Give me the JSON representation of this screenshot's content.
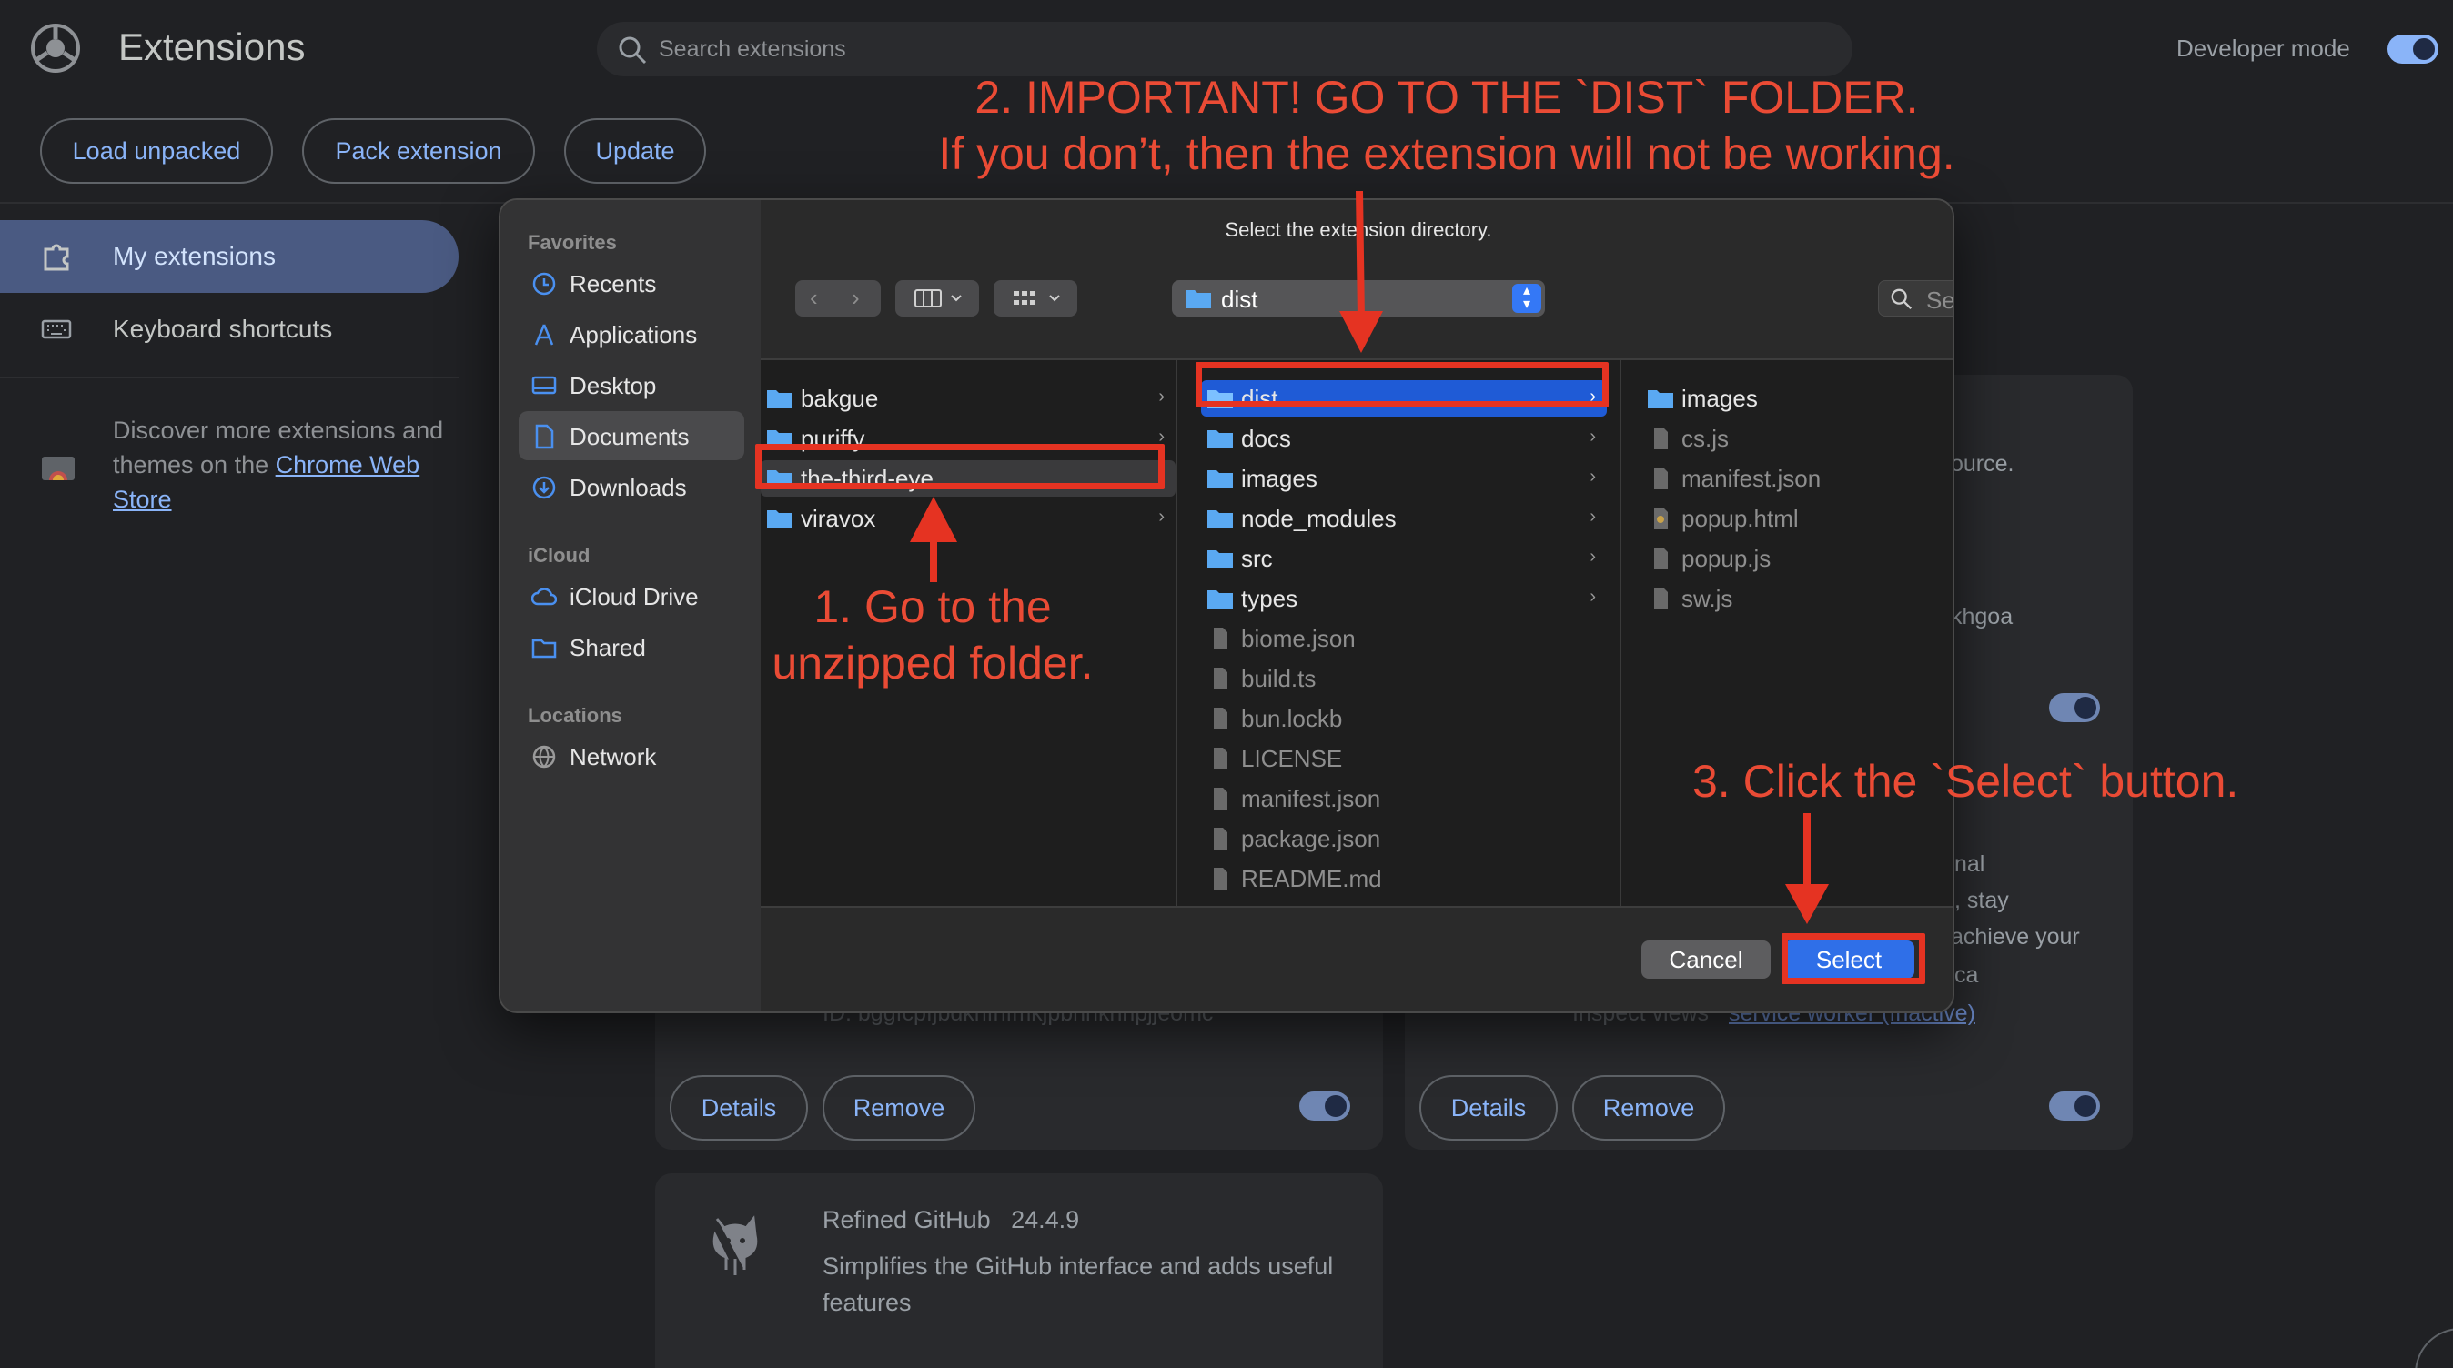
{
  "page": {
    "title": "Extensions",
    "search_placeholder": "Search extensions",
    "developer_mode_label": "Developer mode",
    "buttons": {
      "load_unpacked": "Load unpacked",
      "pack_extension": "Pack extension",
      "update": "Update"
    },
    "sidebar": {
      "my_extensions": "My extensions",
      "keyboard_shortcuts": "Keyboard shortcuts",
      "discover_text": "Discover more extensions and themes on the",
      "store_link": "Chrome Web Store"
    },
    "cards": {
      "partial_ource": "ource.",
      "partial_khgoa": "khgoa",
      "partial_nal": "nal",
      "partial_stay": ", stay",
      "partial_achieve": "achieve your",
      "partial_ca": "ca",
      "id_partial": "ID: bggfcpfjbdkhfhfmkjpbhnkhnpjjeomc",
      "inspect_views": "Inspect views",
      "service_worker": "service worker (Inactive)",
      "details": "Details",
      "remove": "Remove",
      "refined_name": "Refined GitHub",
      "refined_version": "24.4.9",
      "refined_desc": "Simplifies the GitHub interface and adds useful features"
    }
  },
  "dialog": {
    "prompt": "Select the extension directory.",
    "location": "dist",
    "search_placeholder": "Search",
    "sidebar": {
      "favorites_header": "Favorites",
      "favorites": [
        "Recents",
        "Applications",
        "Desktop",
        "Documents",
        "Downloads"
      ],
      "icloud_header": "iCloud",
      "icloud": [
        "iCloud Drive",
        "Shared"
      ],
      "locations_header": "Locations",
      "locations": [
        "Network"
      ]
    },
    "column1": [
      "bakgue",
      "puriffy",
      "the-third-eye",
      "viravox"
    ],
    "column2": [
      "dist",
      "docs",
      "images",
      "node_modules",
      "src",
      "types",
      "biome.json",
      "build.ts",
      "bun.lockb",
      "LICENSE",
      "manifest.json",
      "package.json",
      "README.md"
    ],
    "column3": [
      "images",
      "cs.js",
      "manifest.json",
      "popup.html",
      "popup.js",
      "sw.js"
    ],
    "cancel": "Cancel",
    "select": "Select"
  },
  "annotations": {
    "step2_line1": "2. IMPORTANT! GO TO THE `DIST` FOLDER.",
    "step2_line2": "If you don’t, then the extension will not be working.",
    "step1_line1": "1. Go to the",
    "step1_line2": "unzipped folder.",
    "step3": "3. Click the `Select` button.",
    "color": "#ea4b35"
  }
}
